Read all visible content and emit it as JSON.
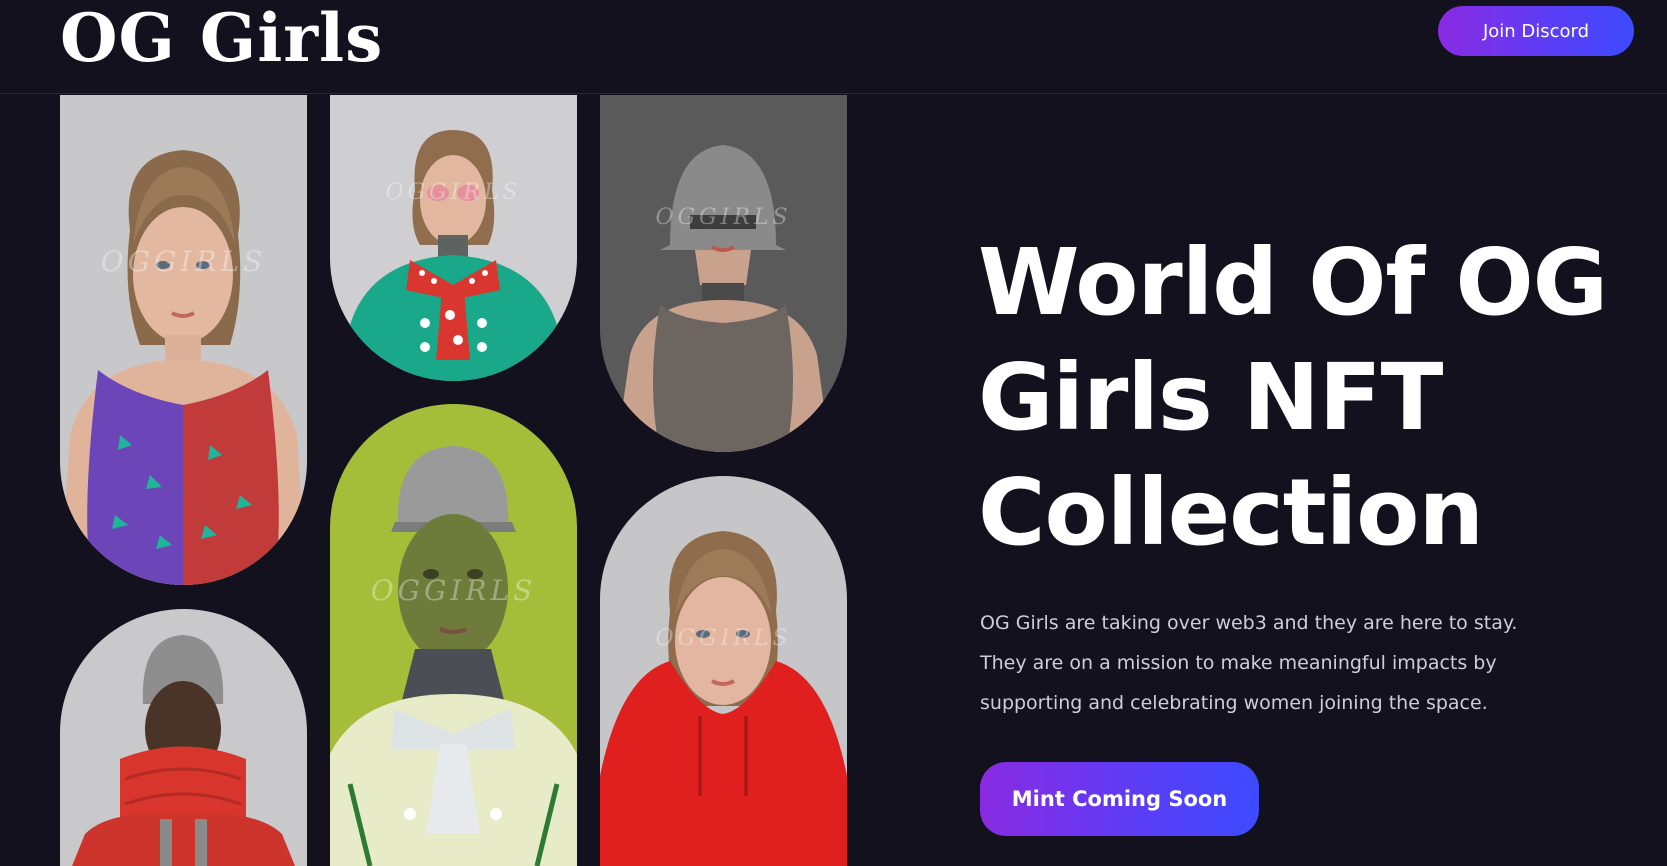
{
  "header": {
    "logo_text": "OG Girls",
    "discord_label": "Join Discord"
  },
  "hero": {
    "title_line1": "World Of OG",
    "title_line2": "Girls NFT",
    "title_line3": "Collection",
    "description": "OG Girls are taking over web3 and they are here to stay. They are on a mission to make meaningful impacts by supporting and celebrating women joining the space.",
    "cta_label": "Mint Coming Soon"
  },
  "gallery": {
    "watermark": "OGGIRLS",
    "cards": [
      {
        "name": "nft-card-patterned-dress",
        "bg": "#c8c8ca"
      },
      {
        "name": "nft-card-sunglasses-bowtie",
        "bg": "#cfcfd1"
      },
      {
        "name": "nft-card-helmet",
        "bg": "#5a5a5a"
      },
      {
        "name": "nft-card-puffer-jacket",
        "bg": "#c9c9cb"
      },
      {
        "name": "nft-card-green-mask",
        "bg": "#a6bd3a"
      },
      {
        "name": "nft-card-red-hoodie",
        "bg": "#c6c6c8"
      }
    ]
  },
  "colors": {
    "background": "#13111e",
    "accent_start": "#8a2be2",
    "accent_end": "#3d4bff",
    "text": "#ffffff"
  }
}
